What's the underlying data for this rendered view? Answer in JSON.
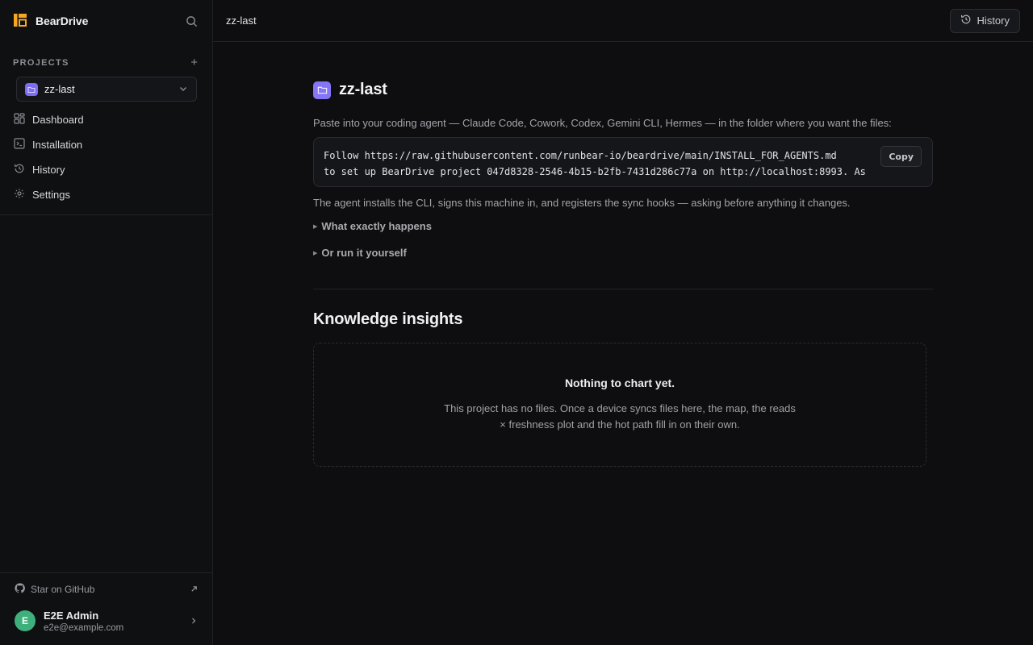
{
  "app": {
    "brand_name": "BearDrive",
    "accent_color": "#f5a623",
    "project_color": "#7c6df2"
  },
  "sidebar": {
    "projects_label": "PROJECTS",
    "add_icon": "plus-icon",
    "project_selector": {
      "value": "zz-last",
      "icon": "chevron-down-icon"
    },
    "nav": [
      {
        "label": "Dashboard",
        "icon": "dashboard-icon"
      },
      {
        "label": "Installation",
        "icon": "terminal-icon"
      },
      {
        "label": "History",
        "icon": "history-icon"
      },
      {
        "label": "Settings",
        "icon": "gear-icon"
      }
    ],
    "github_label": "Star on GitHub",
    "user": {
      "initial": "E",
      "name": "E2E Admin",
      "email": "e2e@example.com",
      "avatar_color": "#3fb07c"
    }
  },
  "topbar": {
    "breadcrumb": "zz-last",
    "history_button": "History"
  },
  "main": {
    "title": "zz-last",
    "paste_instruction": "Paste into your coding agent — Claude Code, Cowork, Codex, Gemini CLI, Hermes — in the folder where you want the files:",
    "code_line_1": "Follow https://raw.githubusercontent.com/runbear-io/beardrive/main/INSTALL_FOR_AGENTS.md",
    "code_line_2": "to set up BearDrive project 047d8328-2546-4b15-b2fb-7431d286c77a on http://localhost:8993. As",
    "copy_button": "Copy",
    "agent_note": "The agent installs the CLI, signs this machine in, and registers the sync hooks — asking before anything it changes.",
    "details_1": "What exactly happens",
    "details_2": "Or run it yourself",
    "insights_title": "Knowledge insights",
    "empty_title": "Nothing to chart yet.",
    "empty_text": "This project has no files. Once a device syncs files here, the map, the reads × freshness plot and the hot path fill in on their own."
  }
}
